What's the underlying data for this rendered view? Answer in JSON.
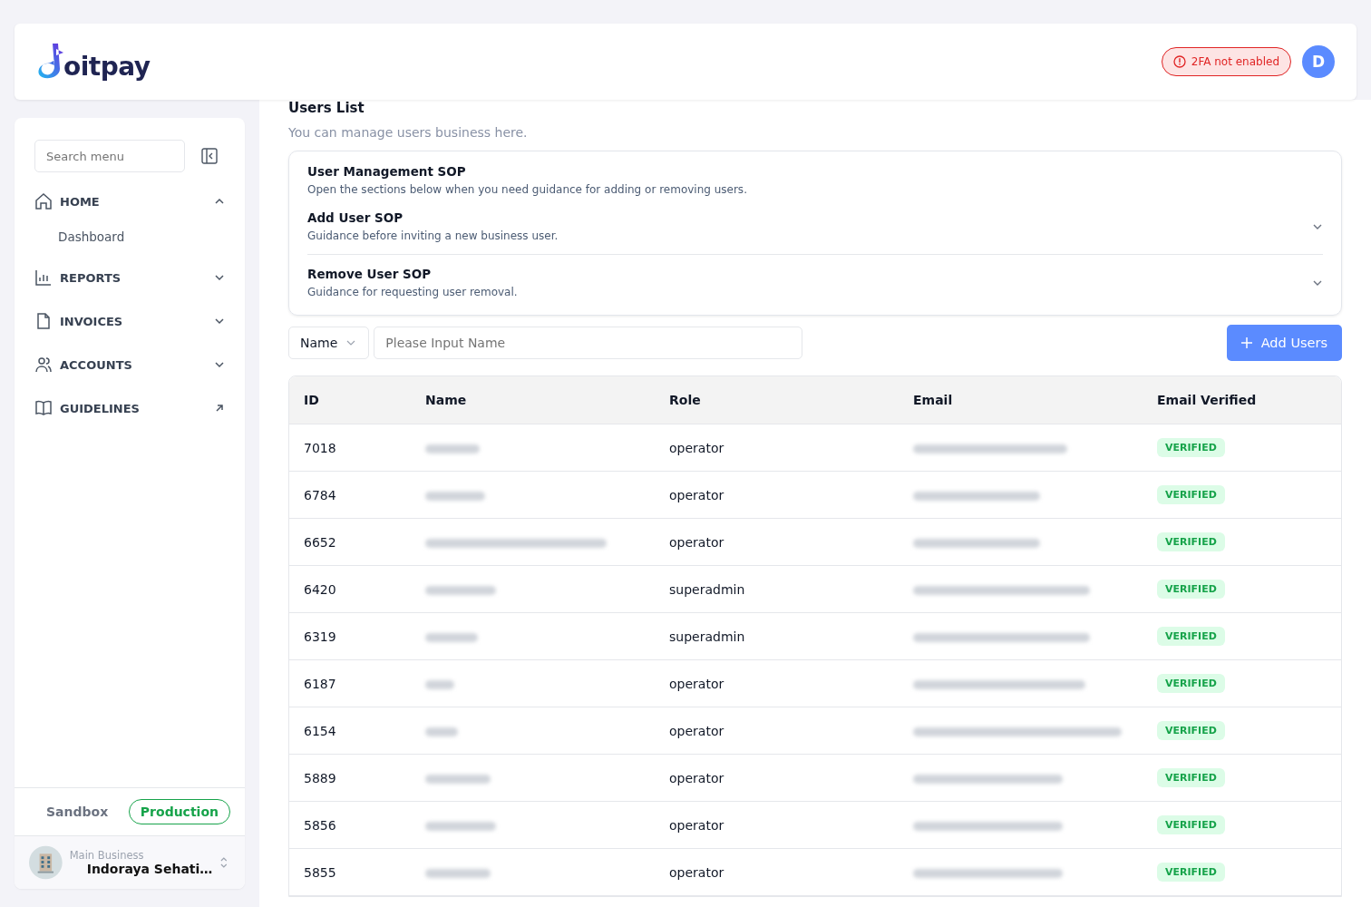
{
  "header": {
    "logo_text": "oitpay",
    "alert": "2FA not enabled",
    "avatar": "D"
  },
  "sidebar": {
    "search": {
      "placeholder": "Search menu"
    },
    "items": [
      {
        "label": "HOME",
        "kind": "group",
        "expanded": true,
        "children": [
          {
            "label": "Dashboard"
          }
        ]
      },
      {
        "label": "REPORTS",
        "kind": "group",
        "expanded": false
      },
      {
        "label": "INVOICES",
        "kind": "group",
        "expanded": false
      },
      {
        "label": "ACCOUNTS",
        "kind": "group",
        "expanded": false
      },
      {
        "label": "GUIDELINES",
        "kind": "external"
      }
    ],
    "environments": [
      {
        "label": "Sandbox",
        "selected": false
      },
      {
        "label": "Production",
        "selected": true
      }
    ],
    "business": {
      "caption": "Main Business",
      "name": "Indoraya Sehati…"
    }
  },
  "page": {
    "title": "Users List",
    "subtitle": "You can manage users business here.",
    "sop": {
      "title": "User Management SOP",
      "text": "Open the sections below when you need guidance for adding or removing users.",
      "sections": [
        {
          "title": "Add User SOP",
          "text": "Guidance before inviting a new business user.",
          "expanded": false
        },
        {
          "title": "Remove User SOP",
          "text": "Guidance for requesting user removal.",
          "expanded": false
        }
      ]
    },
    "filter": {
      "field": "Name",
      "placeholder": "Please Input Name"
    },
    "add_button": "Add Users",
    "table": {
      "columns": [
        "ID",
        "Name",
        "Role",
        "Email",
        "Email Verified"
      ],
      "rows": [
        {
          "id": "7018",
          "role": "operator",
          "verified": true,
          "badge": "VERIFIED"
        },
        {
          "id": "6784",
          "role": "operator",
          "verified": true,
          "badge": "VERIFIED"
        },
        {
          "id": "6652",
          "role": "operator",
          "verified": true,
          "badge": "VERIFIED"
        },
        {
          "id": "6420",
          "role": "superadmin",
          "verified": true,
          "badge": "VERIFIED"
        },
        {
          "id": "6319",
          "role": "superadmin",
          "verified": true,
          "badge": "VERIFIED"
        },
        {
          "id": "6187",
          "role": "operator",
          "verified": true,
          "badge": "VERIFIED"
        },
        {
          "id": "6154",
          "role": "operator",
          "verified": true,
          "badge": "VERIFIED"
        },
        {
          "id": "5889",
          "role": "operator",
          "verified": true,
          "badge": "VERIFIED"
        },
        {
          "id": "5856",
          "role": "operator",
          "verified": true,
          "badge": "VERIFIED"
        },
        {
          "id": "5855",
          "role": "operator",
          "verified": true,
          "badge": "VERIFIED"
        }
      ]
    }
  }
}
